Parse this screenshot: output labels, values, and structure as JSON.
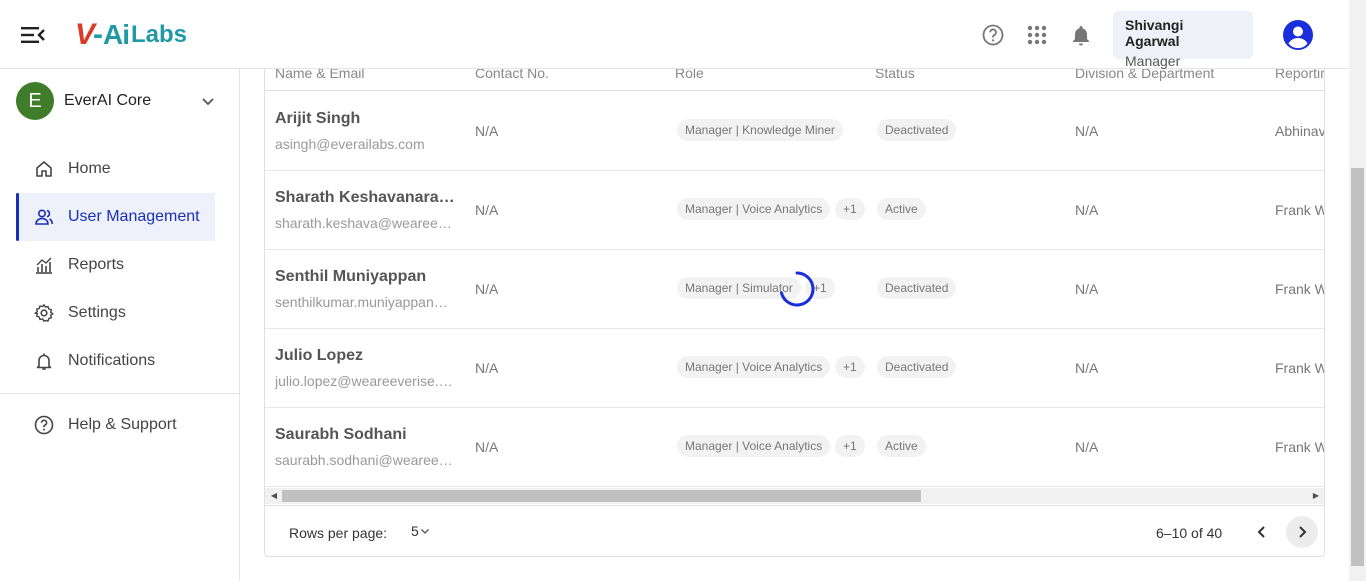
{
  "header": {
    "logo": {
      "v": "V",
      "dash": "-",
      "ai": "Ai",
      "labs": "Labs"
    },
    "icons": [
      "help-circle-icon",
      "apps-grid-icon",
      "bell-icon",
      "account-circle-icon"
    ],
    "user": {
      "name": "Shivangi Agarwal",
      "role": "Manager"
    },
    "accent": "#1a2fb8"
  },
  "sidebar": {
    "org": {
      "initial": "E",
      "name": "EverAI Core",
      "badge_color": "#3f7d2a"
    },
    "items": [
      {
        "label": "Home",
        "icon": "home-icon"
      },
      {
        "label": "User Management",
        "icon": "users-icon",
        "active": true
      },
      {
        "label": "Reports",
        "icon": "chart-icon"
      },
      {
        "label": "Settings",
        "icon": "gear-icon"
      },
      {
        "label": "Notifications",
        "icon": "bell-icon"
      }
    ],
    "help": {
      "label": "Help & Support",
      "icon": "help-circle-icon"
    }
  },
  "table": {
    "columns": [
      "Name & Email",
      "Contact No.",
      "Role",
      "Status",
      "Division & Department",
      "Reporting"
    ],
    "rows": [
      {
        "name": "Arijit Singh",
        "email": "asingh@everailabs.com",
        "contact": "N/A",
        "role": "Manager | Knowledge Miner",
        "extra": "",
        "status": "Deactivated",
        "division": "N/A",
        "reporting": "Abhinav"
      },
      {
        "name": "Sharath Keshavanarayana",
        "email": "sharath.keshava@weareeverise.com",
        "contact": "N/A",
        "role": "Manager | Voice Analytics",
        "extra": "+1",
        "status": "Active",
        "division": "N/A",
        "reporting": "Frank W"
      },
      {
        "name": "Senthil Muniyappan",
        "email": "senthilkumar.muniyappan@weareeverise.com",
        "contact": "N/A",
        "role": "Manager | Simulator",
        "extra": "+1",
        "status": "Deactivated",
        "division": "N/A",
        "reporting": "Frank W"
      },
      {
        "name": "Julio Lopez",
        "email": "julio.lopez@weareeverise.com",
        "contact": "N/A",
        "role": "Manager | Voice Analytics",
        "extra": "+1",
        "status": "Deactivated",
        "division": "N/A",
        "reporting": "Frank W"
      },
      {
        "name": "Saurabh Sodhani",
        "email": "saurabh.sodhani@weareeverise.com",
        "contact": "N/A",
        "role": "Manager | Voice Analytics",
        "extra": "+1",
        "status": "Active",
        "division": "N/A",
        "reporting": "Frank W"
      }
    ]
  },
  "pagination": {
    "rows_per_page_label": "Rows per page:",
    "rows_per_page": "5",
    "range": "6–10 of 40"
  }
}
